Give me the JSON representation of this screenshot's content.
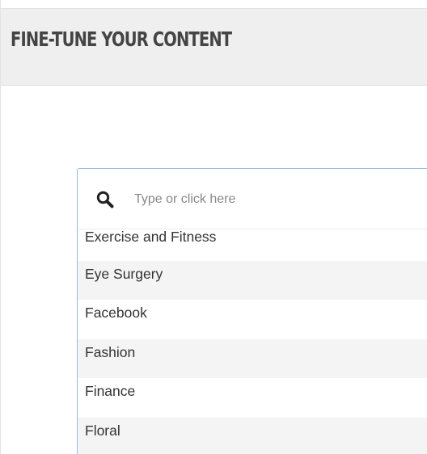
{
  "header": {
    "title": "FINE-TUNE YOUR CONTENT"
  },
  "search": {
    "icon": "search-icon",
    "placeholder": "Type or click here",
    "value": ""
  },
  "options": [
    {
      "label": "Exercise and Fitness"
    },
    {
      "label": "Eye Surgery"
    },
    {
      "label": "Facebook"
    },
    {
      "label": "Fashion"
    },
    {
      "label": "Finance"
    },
    {
      "label": "Floral"
    }
  ],
  "colors": {
    "header_bg": "#efefef",
    "focus_border": "#8fbce8",
    "stripe_bg": "#f4f4f4",
    "text": "#333333"
  }
}
